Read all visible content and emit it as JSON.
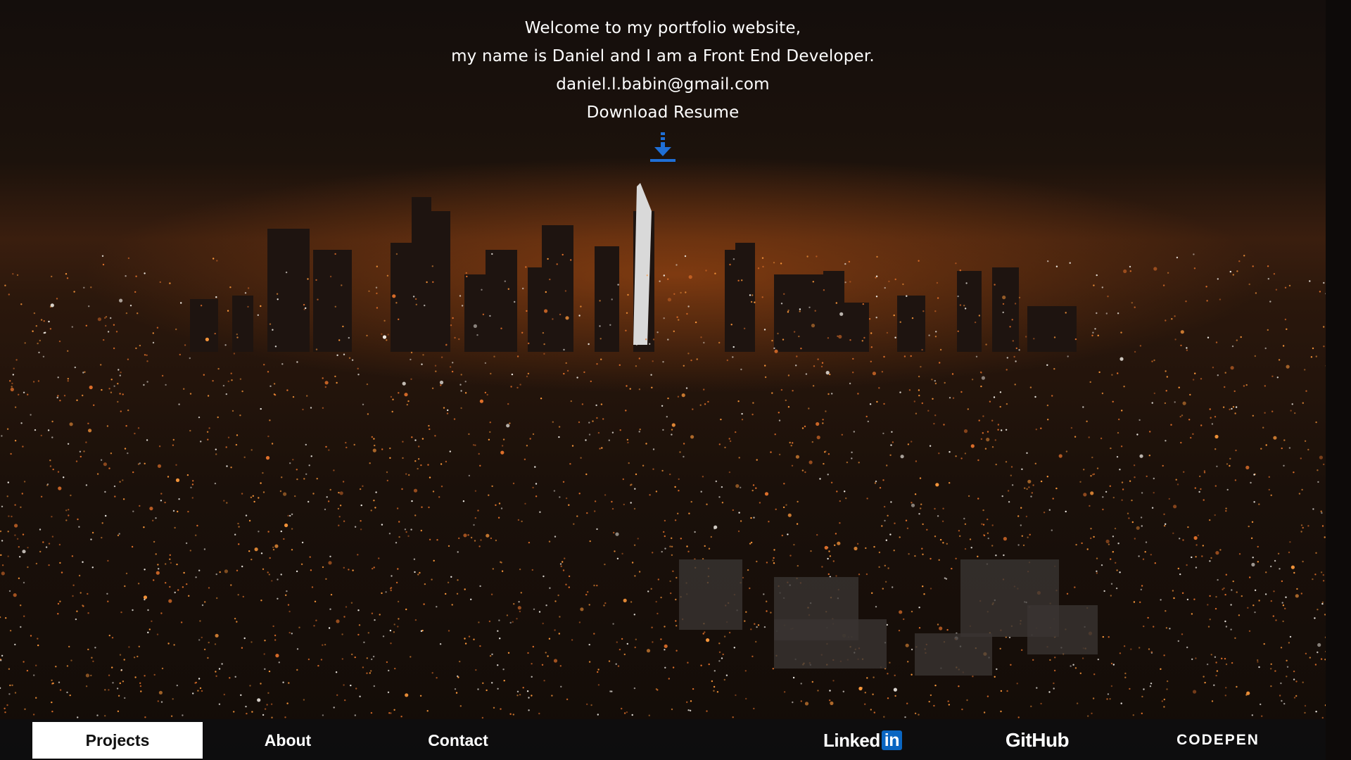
{
  "intro": {
    "line1": "Welcome to my portfolio website,",
    "line2": "my name is Daniel and I am a Front End Developer.",
    "email": "daniel.l.babin@gmail.com",
    "download_label": "Download Resume",
    "download_icon": "download-arrow-icon"
  },
  "nav": {
    "items": [
      {
        "label": "Projects",
        "active": true
      },
      {
        "label": "About",
        "active": false
      },
      {
        "label": "Contact",
        "active": false
      }
    ]
  },
  "social": {
    "linkedin_text": "Linked",
    "linkedin_box": "in",
    "github": "GitHub",
    "codepen": "CODEPEN"
  },
  "colors": {
    "accent": "#0a66c2",
    "active_tab_bg": "#ffffff",
    "text": "#ffffff",
    "city_glow": "#be5514"
  }
}
